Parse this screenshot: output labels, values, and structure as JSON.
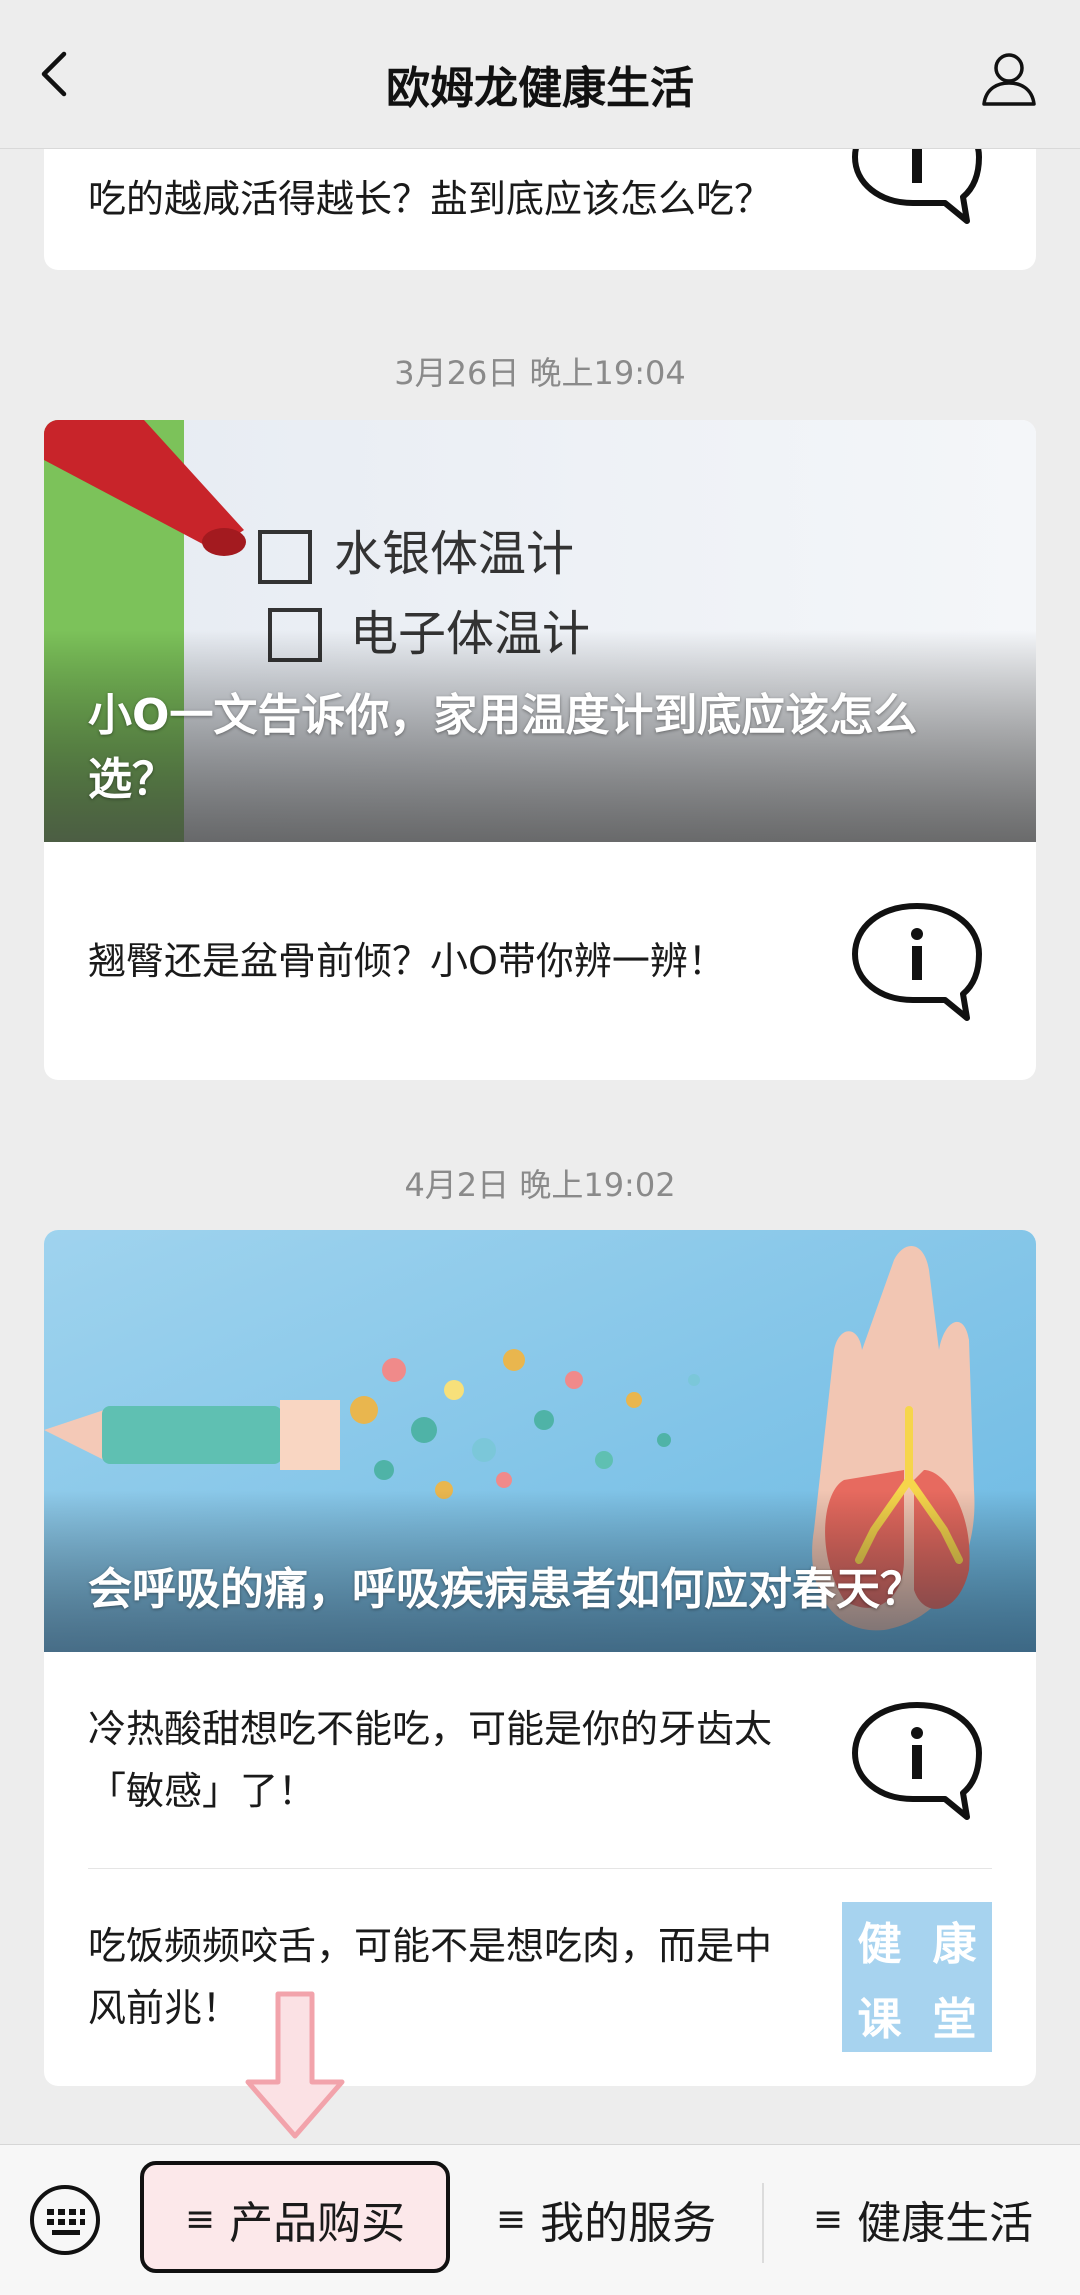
{
  "header": {
    "title": "欧姆龙健康生活"
  },
  "card0": {
    "partial_text": "吃的越咸活得越长？盐到底应该怎么吃？"
  },
  "dates": [
    "3月26日 晚上19:04",
    "4月2日 晚上19:02"
  ],
  "card1": {
    "hero_title": "小O一文告诉你，家用温度计到底应该怎么选？",
    "hero_image_text_1": "水银体温计",
    "hero_image_text_2": "电子体温计",
    "rows": [
      {
        "text": "翘臀还是盆骨前倾？小O带你辨一辨！"
      }
    ]
  },
  "card2": {
    "hero_title": "会呼吸的痛，呼吸疾病患者如何应对春天？",
    "rows": [
      {
        "text": "冷热酸甜想吃不能吃，可能是你的牙齿太「敏感」了！"
      },
      {
        "text": "吃饭频频咬舌，可能不是想吃肉，而是中风前兆！"
      }
    ],
    "thumb_chars": [
      "健",
      "康",
      "课",
      "堂"
    ]
  },
  "bottom_menu": {
    "items": [
      {
        "label": "产品购买",
        "icon": "≡"
      },
      {
        "label": "我的服务",
        "icon": "≡"
      },
      {
        "label": "健康生活",
        "icon": "≡"
      }
    ]
  },
  "colors": {
    "highlight": "#fce8ea",
    "arrow": "#f5b5bb",
    "health_thumb": "#a7d3ef"
  }
}
